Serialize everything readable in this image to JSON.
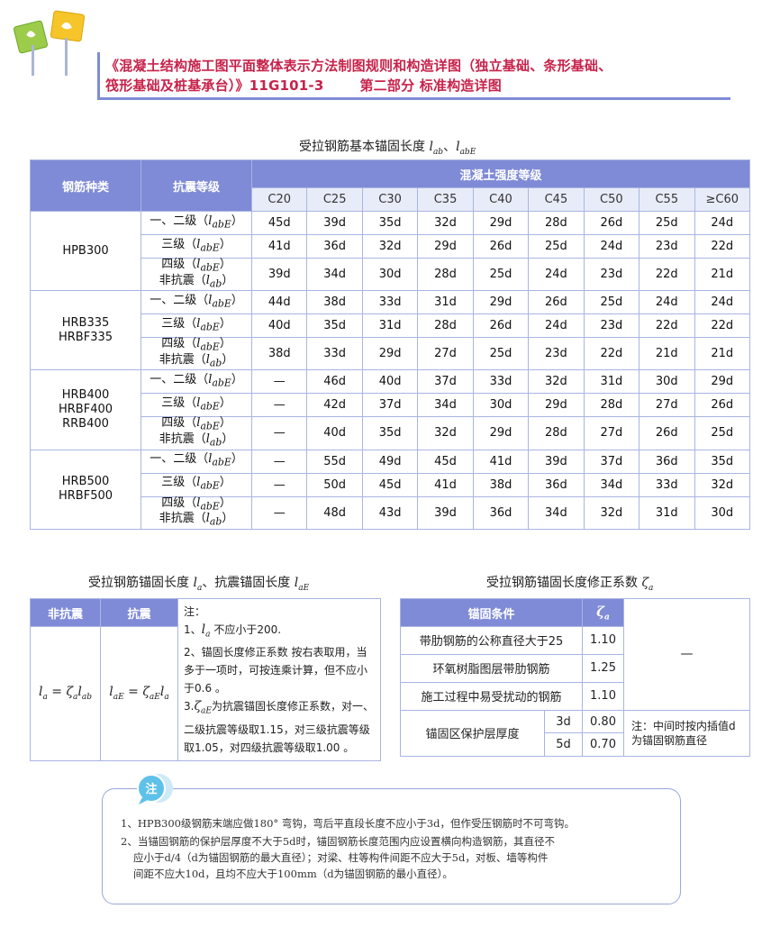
{
  "header": {
    "title_line1": "《混凝土结构施工图平面整体表示方法制图规则和构造详图（独立基础、条形基础、",
    "title_line2": "筏形基础及桩基承台）》11G101-3",
    "part": "第二部分  标准构造详图"
  },
  "main_table": {
    "caption": "受拉钢筋基本锚固长度",
    "caption_sym1": "l",
    "caption_sub1": "ab",
    "caption_sep": "、",
    "caption_sym2": "l",
    "caption_sub2": "abE",
    "col_rebar_type": "钢筋种类",
    "col_seismic": "抗震等级",
    "col_concrete": "混凝土强度等级",
    "grades": [
      "C20",
      "C25",
      "C30",
      "C35",
      "C40",
      "C45",
      "C50",
      "C55",
      "≥C60"
    ],
    "level_labels": {
      "l12": "一、二级",
      "l3": "三级",
      "l4": "四级",
      "non": "非抗震",
      "sym_l": "l",
      "sub_abE": "abE",
      "sub_ab": "ab"
    },
    "groups": [
      {
        "name_lines": [
          "HPB300"
        ],
        "rows": [
          [
            "45d",
            "39d",
            "35d",
            "32d",
            "29d",
            "28d",
            "26d",
            "25d",
            "24d"
          ],
          [
            "41d",
            "36d",
            "32d",
            "29d",
            "26d",
            "25d",
            "24d",
            "23d",
            "22d"
          ],
          [
            "39d",
            "34d",
            "30d",
            "28d",
            "25d",
            "24d",
            "23d",
            "22d",
            "21d"
          ]
        ]
      },
      {
        "name_lines": [
          "HRB335",
          "HRBF335"
        ],
        "rows": [
          [
            "44d",
            "38d",
            "33d",
            "31d",
            "29d",
            "26d",
            "25d",
            "24d",
            "24d"
          ],
          [
            "40d",
            "35d",
            "31d",
            "28d",
            "26d",
            "24d",
            "23d",
            "22d",
            "22d"
          ],
          [
            "38d",
            "33d",
            "29d",
            "27d",
            "25d",
            "23d",
            "22d",
            "21d",
            "21d"
          ]
        ]
      },
      {
        "name_lines": [
          "HRB400",
          "HRBF400",
          "RRB400"
        ],
        "rows": [
          [
            "—",
            "46d",
            "40d",
            "37d",
            "33d",
            "32d",
            "31d",
            "30d",
            "29d"
          ],
          [
            "—",
            "42d",
            "37d",
            "34d",
            "30d",
            "29d",
            "28d",
            "27d",
            "26d"
          ],
          [
            "—",
            "40d",
            "35d",
            "32d",
            "29d",
            "28d",
            "27d",
            "26d",
            "25d"
          ]
        ]
      },
      {
        "name_lines": [
          "HRB500",
          "HRBF500"
        ],
        "rows": [
          [
            "—",
            "55d",
            "49d",
            "45d",
            "41d",
            "39d",
            "37d",
            "36d",
            "35d"
          ],
          [
            "—",
            "50d",
            "45d",
            "41d",
            "38d",
            "36d",
            "34d",
            "33d",
            "32d"
          ],
          [
            "—",
            "48d",
            "43d",
            "39d",
            "36d",
            "34d",
            "32d",
            "31d",
            "30d"
          ]
        ]
      }
    ]
  },
  "la_table": {
    "caption_text": "受拉钢筋锚固长度",
    "caption_sym_la": "l",
    "caption_sub_a": "a",
    "caption_mid": "、抗震锚固长度",
    "caption_sym_lae": "l",
    "caption_sub_ae": "aE",
    "col_non": "非抗震",
    "col_seismic": "抗震",
    "formula_non": "l",
    "formula_non_sub": "a",
    "formula_non_rhs": " = ζ",
    "formula_non_rhs_sub": "a",
    "formula_non_rhs2": "l",
    "formula_non_rhs2_sub": "ab",
    "formula_seis": "l",
    "formula_seis_sub": "aE",
    "formula_seis_rhs": " = ζ",
    "formula_seis_rhs_sub": "aE",
    "formula_seis_rhs2": "l",
    "formula_seis_rhs2_sub": "a",
    "note_head": "注：",
    "note1_pre": "1、",
    "note1_sym": "l",
    "note1_sub": "a",
    "note1_post": " 不应小于200.",
    "note2": "2、锚固长度修正系数    按右表取用，当多于一项时，可按连乘计算，但不应小于0.6 。",
    "note3_pre": "3.",
    "note3_sym": "ζ",
    "note3_sub": "aE",
    "note3_post": "为抗震锚固长度修正系数，对一、二级抗震等级取1.15，对三级抗震等级取1.05，对四级抗震等级取1.00 。"
  },
  "zeta_table": {
    "caption_text": "受拉钢筋锚固长度修正系数",
    "caption_sym": "ζ",
    "caption_sub": "a",
    "col_condition": "锚固条件",
    "col_zeta": "ζ",
    "col_zeta_sub": "a",
    "rows": [
      {
        "condition": "带肋钢筋的公称直径大于25",
        "value": "1.10"
      },
      {
        "condition": "环氧树脂图层带肋钢筋",
        "value": "1.25"
      },
      {
        "condition": "施工过程中易受扰动的钢筋",
        "value": "1.10"
      }
    ],
    "dash": "—",
    "cover_label": "锚固区保护层厚度",
    "cover_rows": [
      {
        "thickness": "3d",
        "value": "0.80"
      },
      {
        "thickness": "5d",
        "value": "0.70"
      }
    ],
    "cover_note": "注：中间时按内插值d为锚固钢筋直径"
  },
  "notes": {
    "icon_label": "注",
    "line1": "1、HPB300级钢筋末端应做180° 弯钩，弯后平直段长度不应小于3d，但作受压钢筋时不可弯钩。",
    "line2": "2、当锚固钢筋的保护层厚度不大于5d时，锚固钢筋长度范围内应设置横向构造钢筋，其直径不",
    "line3": "应小于d/4（d为锚固钢筋的最大直径）；对梁、柱等构件间距不应大于5d，对板、墙等构件",
    "line4": "间距不应大10d，且均不应大于100mm（d为锚固钢筋的最小直径）。"
  },
  "colors": {
    "accent": "#7f8bd6",
    "title": "#c7234b",
    "border": "#a9b5e2"
  }
}
